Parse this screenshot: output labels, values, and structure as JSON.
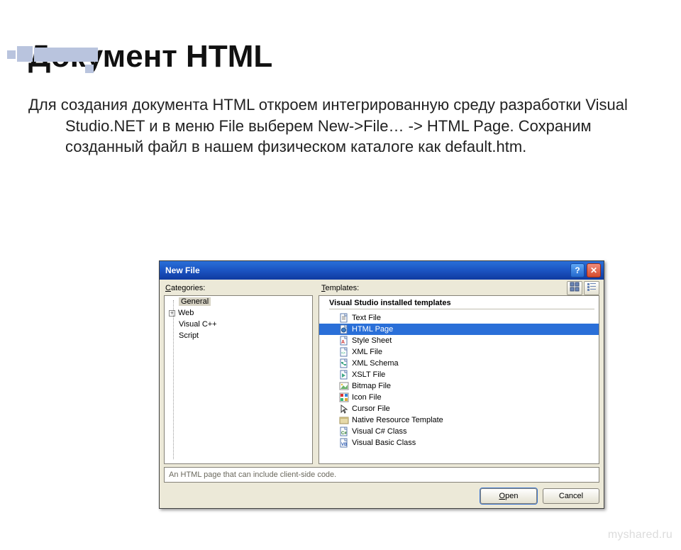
{
  "slide": {
    "title": "Документ HTML",
    "body": "Для создания документа HTML откроем интегрированную среду разработки Visual Studio.NET и в меню File выберем New->File… -> HTML Page. Сохраним созданный файл в нашем физическом каталоге как default.htm."
  },
  "dialog": {
    "title": "New File",
    "labels": {
      "categories": "Categories:",
      "templates": "Templates:",
      "cat_accel": "C",
      "tpl_accel": "T"
    },
    "categories": [
      {
        "label": "General",
        "selected": true,
        "expander": ""
      },
      {
        "label": "Web",
        "selected": false,
        "expander": "+"
      },
      {
        "label": "Visual C++",
        "selected": false,
        "expander": ""
      },
      {
        "label": "Script",
        "selected": false,
        "expander": ""
      }
    ],
    "group_header": "Visual Studio installed templates",
    "templates": [
      {
        "label": "Text File",
        "icon": "text",
        "selected": false
      },
      {
        "label": "HTML Page",
        "icon": "html",
        "selected": true
      },
      {
        "label": "Style Sheet",
        "icon": "css",
        "selected": false
      },
      {
        "label": "XML File",
        "icon": "xml",
        "selected": false
      },
      {
        "label": "XML Schema",
        "icon": "xsd",
        "selected": false
      },
      {
        "label": "XSLT File",
        "icon": "xslt",
        "selected": false
      },
      {
        "label": "Bitmap File",
        "icon": "bmp",
        "selected": false
      },
      {
        "label": "Icon File",
        "icon": "icon",
        "selected": false
      },
      {
        "label": "Cursor File",
        "icon": "cursor",
        "selected": false
      },
      {
        "label": "Native Resource Template",
        "icon": "res",
        "selected": false
      },
      {
        "label": "Visual C# Class",
        "icon": "cs",
        "selected": false
      },
      {
        "label": "Visual Basic Class",
        "icon": "vb",
        "selected": false
      }
    ],
    "description": "An HTML page that can include client-side code.",
    "buttons": {
      "open": "Open",
      "open_accel": "O",
      "cancel": "Cancel"
    },
    "titlebar_help": "?",
    "titlebar_close": "✕"
  },
  "watermark": "myshared.ru"
}
